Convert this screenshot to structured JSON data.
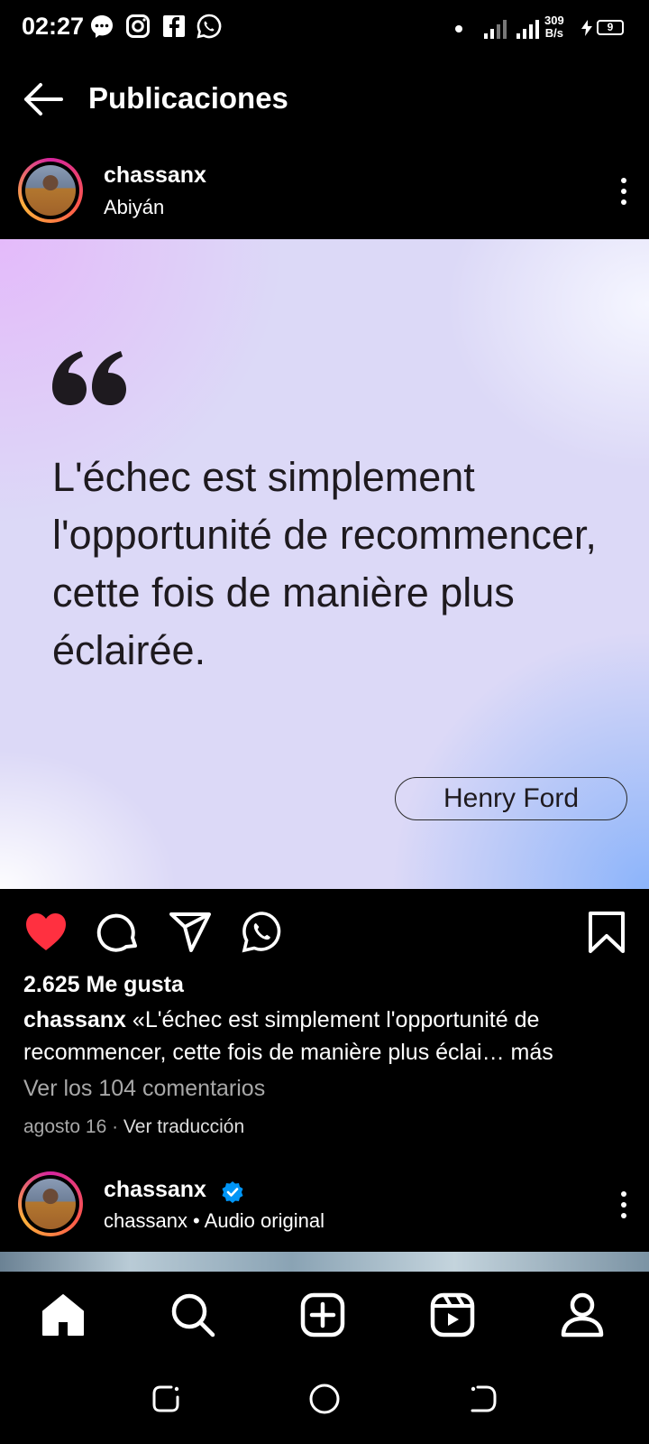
{
  "status_bar": {
    "time": "02:27",
    "speed_value": "309",
    "speed_unit": "B/s",
    "battery": "9",
    "icons": [
      "messenger-icon",
      "instagram-icon",
      "facebook-icon",
      "whatsapp-icon",
      "dot-icon",
      "signal-icon",
      "signal-icon",
      "charging-icon",
      "battery-icon"
    ]
  },
  "header": {
    "title": "Publicaciones",
    "back_icon": "arrow-left-icon"
  },
  "post": {
    "username": "chassanx",
    "location": "Abiyán",
    "quote": "L'échec est simplement l'opportunité de recommencer, cette fois de manière plus éclairée.",
    "author": "Henry Ford",
    "liked": true,
    "likes": "2.625 Me gusta",
    "caption_user": "chassanx",
    "caption_text": "«L'échec est simplement l'opportunité de recommencer, cette fois de manière plus éclai",
    "caption_more": "… más",
    "comments_link": "Ver los 104 comentarios",
    "date": "agosto 16",
    "separator": " · ",
    "translate": "Ver traducción",
    "colors": {
      "like": "#ff3040",
      "verified": "#0095f6"
    }
  },
  "next_post": {
    "username": "chassanx",
    "verified": true,
    "subtitle": "chassanx • Audio original"
  },
  "bottom_nav": [
    "home-icon",
    "search-icon",
    "create-icon",
    "reels-icon",
    "profile-icon"
  ],
  "system_nav": [
    "recents-icon",
    "home-circle-icon",
    "back-icon"
  ]
}
